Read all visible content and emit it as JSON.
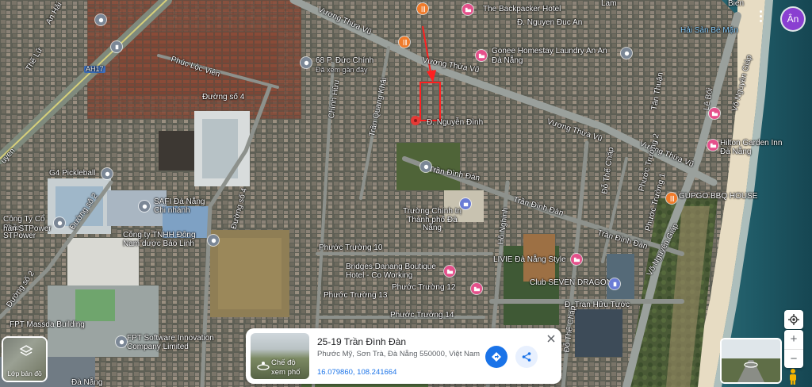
{
  "map": {
    "place_labels": [
      {
        "id": "backpacker",
        "text": "The Backpacker Hotel"
      },
      {
        "id": "nguyen-duc-an",
        "text": "Đ. Nguyen Đuc An"
      },
      {
        "id": "gonee",
        "text": "Gonee Homestay Laundry An An"
      },
      {
        "id": "gonee2",
        "text": "Đà Nẵng"
      },
      {
        "id": "hai-san",
        "text": "Hải Sản Bé Mặn"
      },
      {
        "id": "68p",
        "text": "68 P. Đức Chính"
      },
      {
        "id": "68p-sub",
        "text": "Đã xem gần đây"
      },
      {
        "id": "vuong-thua-vu-1",
        "text": "Vương Thừa Vũ"
      },
      {
        "id": "vuong-thua-vu-2",
        "text": "Vương Thừa Vũ"
      },
      {
        "id": "vuong-thua-vu-3",
        "text": "Vương Thừa Vũ"
      },
      {
        "id": "vuong-thua-vu-4",
        "text": "Vương Thừa Vũ"
      },
      {
        "id": "phuc-loc-vien",
        "text": "Phúc Lộc Viên"
      },
      {
        "id": "duong-so-4a",
        "text": "Đường số 4"
      },
      {
        "id": "duong-so-4b",
        "text": "Đường số 4"
      },
      {
        "id": "duong-so-2a",
        "text": "Đường số 2"
      },
      {
        "id": "duong-so-2b",
        "text": "Đường số 2"
      },
      {
        "id": "nguyen-dinh",
        "text": "Đ. Nguyễn Đình"
      },
      {
        "id": "tran-dinh-dan-1",
        "text": "Trần Đình Đàn"
      },
      {
        "id": "tran-dinh-dan-2",
        "text": "Trần Đình Đàn"
      },
      {
        "id": "tran-dinh-dan-3",
        "text": "Trần Đình Đàn"
      },
      {
        "id": "hilton",
        "text": "Hilton Garden Inn Đà Nẵng"
      },
      {
        "id": "gupgo",
        "text": "GUPGO BBQ HOUSE"
      },
      {
        "id": "g4",
        "text": "G4 Pickleball"
      },
      {
        "id": "safi",
        "text": "SAFI Đà Nẵng Chi nhánh"
      },
      {
        "id": "congty-co",
        "text": "Công Ty Cổ Phần STPower"
      },
      {
        "id": "congty-tnhh",
        "text": "Công ty TNHH Đông Nam dược Bảo Linh"
      },
      {
        "id": "truong-chinh-tri",
        "text": "Trường Chính trị Thành phố Đà Nẵng"
      },
      {
        "id": "phuoc-truong-10",
        "text": "Phước Trường 10"
      },
      {
        "id": "phuoc-truong-12",
        "text": "Phước Trường 12"
      },
      {
        "id": "phuoc-truong-13",
        "text": "Phước Trường 13"
      },
      {
        "id": "phuoc-truong-14",
        "text": "Phước Trường 14"
      },
      {
        "id": "phuoc-truong-2",
        "text": "Phước Trường 2"
      },
      {
        "id": "phuoc-truong-1",
        "text": "Phước Trường 1"
      },
      {
        "id": "bridges",
        "text": "Bridges Danang Boutique Hotel - Co Working"
      },
      {
        "id": "livie",
        "text": "LIVIE Đà Nẵng Style"
      },
      {
        "id": "club-seven",
        "text": "Club SEVEN DRAGON"
      },
      {
        "id": "tran-huu-tuoc",
        "text": "Đ. Tran Hữu Tước"
      },
      {
        "id": "fpt-massda",
        "text": "FPT Massda Building"
      },
      {
        "id": "fpt-software",
        "text": "FPT Software Innovation Company Limited"
      },
      {
        "id": "vo-nguyen-giap-1",
        "text": "Võ Nguyên Giáp"
      },
      {
        "id": "vo-nguyen-giap-2",
        "text": "Võ Nguyên Giáp"
      },
      {
        "id": "do-the-chap-1",
        "text": "Đỗ Thế Chấp"
      },
      {
        "id": "do-the-chap-2",
        "text": "Đỗ Thế Chấp"
      },
      {
        "id": "ho-nghinh",
        "text": "Hồ Nghinh"
      },
      {
        "id": "chinh-huu",
        "text": "Chính Hữu"
      },
      {
        "id": "tran-quang-khai",
        "text": "Trần Quang Khải"
      },
      {
        "id": "the-lu",
        "text": "Thế Lữ"
      },
      {
        "id": "an-hai",
        "text": "An Hải"
      },
      {
        "id": "ah17",
        "text": "AH17"
      },
      {
        "id": "le-boi",
        "text": "Lê Bôi"
      },
      {
        "id": "tan-thuan",
        "text": "Tân Thuận"
      },
      {
        "id": "lam",
        "text": "Lam"
      },
      {
        "id": "uyen",
        "text": "uyen"
      },
      {
        "id": "hanh-stpower",
        "text": "hần STPower"
      },
      {
        "id": "da-nang-bottom",
        "text": "Đà Nẵng"
      },
      {
        "id": "bien",
        "text": "Bien"
      }
    ]
  },
  "card": {
    "address": "25-19 Trần Đình Đàn",
    "sub_address": "Phước Mỹ, Sơn Trà, Đà Nẵng 550000, Việt Nam",
    "coordinates": "16.079860, 108.241664",
    "streetview_label": "Chế độ xem phố"
  },
  "controls": {
    "layers_label": "Lớp bản đồ",
    "avatar_initial": "Ân",
    "zoom_in": "+",
    "zoom_out": "−"
  }
}
